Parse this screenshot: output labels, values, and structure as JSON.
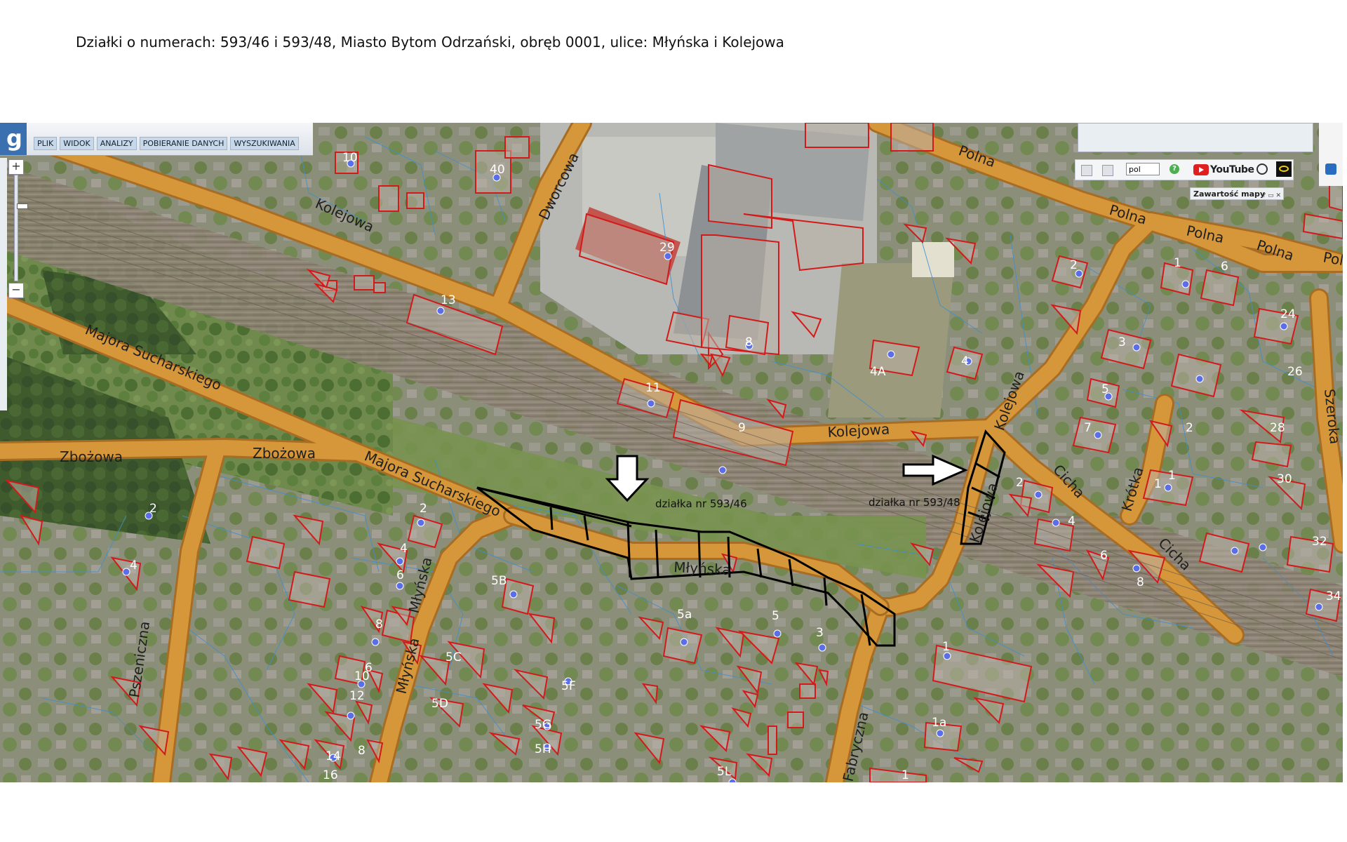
{
  "heading": "Działki o numerach: 593/46 i 593/48, Miasto Bytom Odrzański, obręb 0001, ulice: Młyńska i Kolejowa",
  "menu": [
    "PLIK",
    "WIDOK",
    "ANALIZY",
    "POBIERANIE DANYCH",
    "WYSZUKIWANIA"
  ],
  "zoom": {
    "plus": "+",
    "minus": "−"
  },
  "toolbar": {
    "language": "pol",
    "help": "?",
    "youtube": "YouTube"
  },
  "panel": {
    "title": "Zawartość mapy",
    "buttons": "? ▭ ✕"
  },
  "annotations": {
    "plot1": "działka nr 593/46",
    "plot2": "działka nr 593/48"
  },
  "streets": {
    "kolejowa": "Kolejowa",
    "dworcowa": "Dworcowa",
    "polna": "Polna",
    "majora": "Majora Sucharskiego",
    "zbozowa": "Zbożowa",
    "mlynska": "Młyńska",
    "pszeniczna": "Pszeniczna",
    "fabryczna": "Fabryczna",
    "cicha": "Cicha",
    "krotka": "Krótka",
    "szeroka": "Szeroka"
  },
  "house_numbers": [
    "10",
    "40",
    "29",
    "13",
    "8",
    "11",
    "9",
    "2",
    "4A",
    "4",
    "1",
    "6",
    "24",
    "3",
    "26",
    "5",
    "2",
    "7",
    "28",
    "30",
    "2",
    "32",
    "34",
    "5B",
    "5a",
    "5",
    "3",
    "5C",
    "5F",
    "5D",
    "5G",
    "5H",
    "5L",
    "1a",
    "1",
    "4",
    "6",
    "8",
    "10",
    "12",
    "14",
    "16",
    "2",
    "4",
    "6",
    "8",
    "1",
    "2",
    "4",
    "6",
    "8",
    "1",
    "1"
  ],
  "colors": {
    "road": "#d6963a",
    "road_edge": "#a86c22",
    "building_outline": "#d21a1a",
    "parcel_line": "#3d8fd0",
    "plot_outline": "#000000",
    "arrow_green": "#2fa84a",
    "vegetation": "#6e8f4a",
    "railway": "#8a7a6b"
  }
}
